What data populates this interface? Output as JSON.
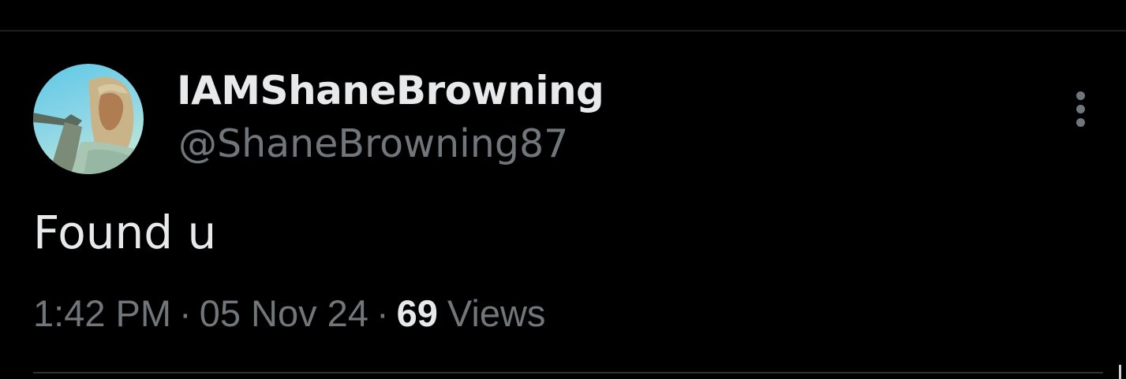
{
  "tweet": {
    "author": {
      "display_name": "IAMShaneBrowning",
      "handle": "@ShaneBrowning87"
    },
    "text": "Found u",
    "meta": {
      "time": "1:42 PM",
      "date": "05 Nov 24",
      "separator": "·",
      "views_count": "69",
      "views_label": "Views"
    },
    "icons": {
      "more": "more-vertical-icon"
    }
  },
  "colors": {
    "background": "#000000",
    "primary_text": "#e7e9ea",
    "secondary_text": "#71767b",
    "divider": "#2f3336"
  }
}
